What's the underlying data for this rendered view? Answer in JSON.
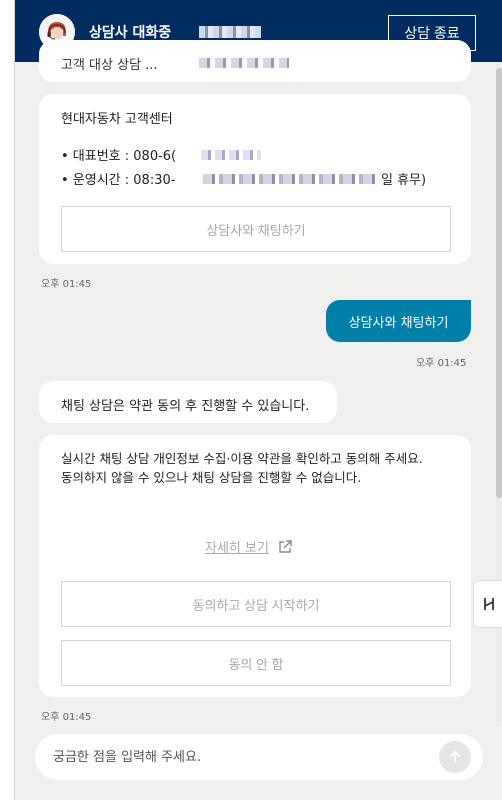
{
  "header": {
    "agent_title": "상담사 대화중",
    "end_label": "상담 종료"
  },
  "messages": {
    "partial_text": "고객 대상 상담 ...",
    "service_card": {
      "title": "현대자동차 고객센터",
      "phone": "• 대표번호 : 080-6(",
      "hours": "• 운영시간 : 08:30-",
      "hours_tail": "일 휴무)",
      "chat_button": "상담사와 채팅하기"
    },
    "time1": "오후 01:45",
    "user_message": "상담사와 채팅하기",
    "time2": "오후 01:45",
    "notice": "채팅 상담은 약관 동의 후 진행할 수 있습니다.",
    "consent_card": {
      "line1": "실시간 채팅 상담 개인정보 수집·이용 약관을 확인하고 동의해 주세요.",
      "line2": "동의하지 않을 수 있으나 채팅 상담을 진행할 수 없습니다.",
      "detail_link": "자세히 보기",
      "agree_button": "동의하고 상담 시작하기",
      "disagree_button": "동의 안 함"
    },
    "time3": "오후 01:45"
  },
  "input": {
    "placeholder": "궁금한 점을 입력해 주세요."
  },
  "colors": {
    "header_bg": "#002c5f",
    "user_bubble": "#007fa8",
    "online_dot": "#3ec36b"
  }
}
